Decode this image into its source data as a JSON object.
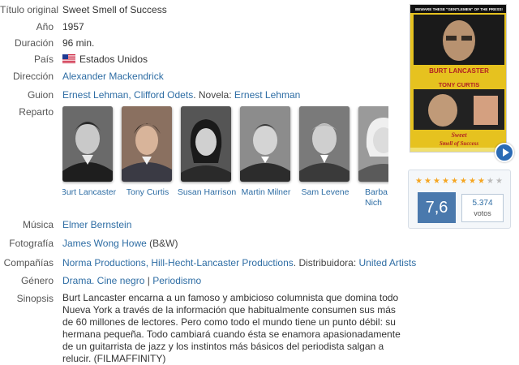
{
  "details": {
    "original_title_label": "Título original",
    "original_title": "Sweet Smell of Success",
    "year_label": "Año",
    "year": "1957",
    "duration_label": "Duración",
    "duration": "96 min.",
    "country_label": "País",
    "country": "Estados Unidos",
    "director_label": "Dirección",
    "director": "Alexander Mackendrick",
    "script_label": "Guion",
    "script_writers": "Ernest Lehman, Clifford Odets",
    "script_novel_prefix": ". Novela: ",
    "script_novel": "Ernest Lehman",
    "cast_label": "Reparto",
    "music_label": "Música",
    "music": "Elmer Bernstein",
    "photography_label": "Fotografía",
    "photography": "James Wong Howe",
    "photography_note": " (B&W)",
    "companies_label": "Compañías",
    "companies": "Norma Productions, Hill-Hecht-Lancaster Productions",
    "distributor_prefix": ". Distribuidora: ",
    "distributor": "United Artists",
    "genre_label": "Género",
    "genre": "Drama. Cine negro",
    "genre_sep": " | ",
    "genre_topic": "Periodismo",
    "synopsis_label": "Sinopsis",
    "synopsis": "Burt Lancaster encarna a un famoso y ambicioso columnista que domina todo Nueva York a través de la información que habitualmente consumen sus más de 60 millones de lectores. Pero como todo el mundo tiene un punto débil: su hermana pequeña. Todo cambiará cuando ésta se enamora apasionadamente de un guitarrista de jazz y los instintos más básicos del periodista salgan a relucir. (FILMAFFINITY)"
  },
  "cast": [
    {
      "name": "Burt Lancaster"
    },
    {
      "name": "Tony Curtis"
    },
    {
      "name": "Susan Harrison"
    },
    {
      "name": "Martin Milner"
    },
    {
      "name": "Sam Levene"
    },
    {
      "name": "Barbara Nichols",
      "name_visible": "Barba Nich"
    }
  ],
  "poster": {
    "tagline": "BEWARE THESE \"GENTLEMEN\" OF THE PRESS!",
    "actor1": "BURT LANCASTER",
    "actor2": "TONY CURTIS",
    "title_line1": "Sweet",
    "title_line2": "Smell of Success"
  },
  "rating": {
    "score": "7,6",
    "votes_count": "5.374",
    "votes_label": "votos",
    "stars_filled": 8,
    "stars_total": 10
  },
  "colors": {
    "link": "#2e6da4",
    "score_bg": "#4a79ad",
    "star_on": "#f5a623",
    "star_off": "#bbbbbb"
  }
}
